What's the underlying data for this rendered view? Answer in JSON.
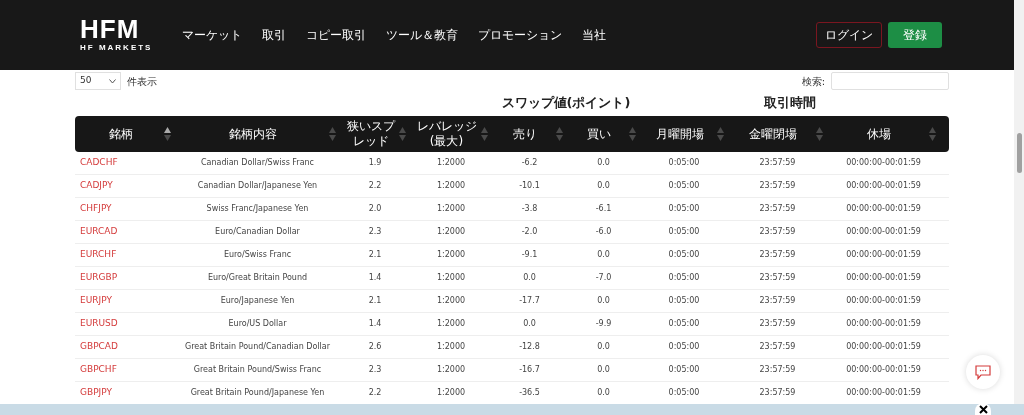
{
  "header": {
    "logo": {
      "mark": "HFM",
      "subtitle": "HF MARKETS"
    },
    "nav": [
      "マーケット",
      "取引",
      "コピー取引",
      "ツール＆教育",
      "プロモーション",
      "当社"
    ],
    "login": "ログイン",
    "register": "登録"
  },
  "controls": {
    "page_size": "50",
    "page_size_label": "件表示",
    "search_label": "検索:"
  },
  "group_headers": [
    {
      "label": "スワップ値(ポイント)"
    },
    {
      "label": "取引時間"
    }
  ],
  "table": {
    "columns": [
      {
        "label": "銘柄",
        "sorted": true
      },
      {
        "label": "銘柄内容",
        "sorted": false
      },
      {
        "label": "狭いスプレッド",
        "sorted": false
      },
      {
        "label": "レバレッジ(最大)",
        "sorted": false
      },
      {
        "label": "売り",
        "sorted": false
      },
      {
        "label": "買い",
        "sorted": false
      },
      {
        "label": "月曜開場",
        "sorted": false
      },
      {
        "label": "金曜閉場",
        "sorted": false
      },
      {
        "label": "休場",
        "sorted": false
      }
    ],
    "rows": [
      [
        "CADCHF",
        "Canadian Dollar/Swiss Franc",
        "1.9",
        "1:2000",
        "-6.2",
        "0.0",
        "0:05:00",
        "23:57:59",
        "00:00:00-00:01:59"
      ],
      [
        "CADJPY",
        "Canadian Dollar/Japanese Yen",
        "2.2",
        "1:2000",
        "-10.1",
        "0.0",
        "0:05:00",
        "23:57:59",
        "00:00:00-00:01:59"
      ],
      [
        "CHFJPY",
        "Swiss Franc/Japanese Yen",
        "2.0",
        "1:2000",
        "-3.8",
        "-6.1",
        "0:05:00",
        "23:57:59",
        "00:00:00-00:01:59"
      ],
      [
        "EURCAD",
        "Euro/Canadian Dollar",
        "2.3",
        "1:2000",
        "-2.0",
        "-6.0",
        "0:05:00",
        "23:57:59",
        "00:00:00-00:01:59"
      ],
      [
        "EURCHF",
        "Euro/Swiss Franc",
        "2.1",
        "1:2000",
        "-9.1",
        "0.0",
        "0:05:00",
        "23:57:59",
        "00:00:00-00:01:59"
      ],
      [
        "EURGBP",
        "Euro/Great Britain Pound",
        "1.4",
        "1:2000",
        "0.0",
        "-7.0",
        "0:05:00",
        "23:57:59",
        "00:00:00-00:01:59"
      ],
      [
        "EURJPY",
        "Euro/Japanese Yen",
        "2.1",
        "1:2000",
        "-17.7",
        "0.0",
        "0:05:00",
        "23:57:59",
        "00:00:00-00:01:59"
      ],
      [
        "EURUSD",
        "Euro/US Dollar",
        "1.4",
        "1:2000",
        "0.0",
        "-9.9",
        "0:05:00",
        "23:57:59",
        "00:00:00-00:01:59"
      ],
      [
        "GBPCAD",
        "Great Britain Pound/Canadian Dollar",
        "2.6",
        "1:2000",
        "-12.8",
        "0.0",
        "0:05:00",
        "23:57:59",
        "00:00:00-00:01:59"
      ],
      [
        "GBPCHF",
        "Great Britain Pound/Swiss Franc",
        "2.3",
        "1:2000",
        "-16.7",
        "0.0",
        "0:05:00",
        "23:57:59",
        "00:00:00-00:01:59"
      ],
      [
        "GBPJPY",
        "Great Britain Pound/Japanese Yen",
        "2.2",
        "1:2000",
        "-36.5",
        "0.0",
        "0:05:00",
        "23:57:59",
        "00:00:00-00:01:59"
      ]
    ]
  }
}
